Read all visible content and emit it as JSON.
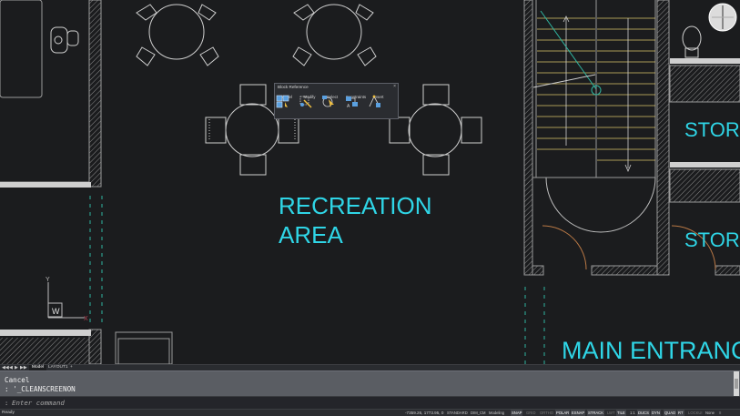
{
  "drawing": {
    "labels": {
      "recreation": "RECREATION",
      "area": "AREA",
      "storage_1": "STOR",
      "storage_2": "STOR",
      "main_entrance": "MAIN ENTRANC"
    },
    "ucs_label": "W",
    "ucs_y": "Y",
    "ucs_x": "X"
  },
  "context_toolbar": {
    "title": "Block Reference",
    "close": "×",
    "groups": [
      {
        "label": "Model",
        "icon": "model-icon"
      },
      {
        "label": "Modify",
        "icon": "modify-icon"
      },
      {
        "label": "Select",
        "icon": "select-icon"
      },
      {
        "label": "Constraints",
        "icon": "constraints-icon"
      },
      {
        "label": "Insert",
        "icon": "insert-icon"
      }
    ]
  },
  "layout_tabs": {
    "nav": [
      "◀◀",
      "◀",
      "▶",
      "▶▶"
    ],
    "tabs": [
      {
        "label": "Model",
        "active": true
      },
      {
        "label": "LAYOUT1",
        "active": false
      }
    ],
    "add": "+"
  },
  "command_window": {
    "history": [
      "Cancel",
      ": '_CLEANSCREENON"
    ],
    "prompt_prefix": ":",
    "input_value": "",
    "input_placeholder": "Enter command"
  },
  "status_bar": {
    "ready": "Ready",
    "coordinates": "-7359.26, 1773.95, 0",
    "buttons": [
      {
        "label": "STANDARD",
        "on": false
      },
      {
        "label": "DIM_CM",
        "on": false
      },
      {
        "label": "Modeling",
        "on": false
      },
      {
        "label": "SNAP",
        "on": true
      },
      {
        "label": "GRID",
        "on": false
      },
      {
        "label": "ORTHO",
        "on": false
      },
      {
        "label": "POLAR",
        "on": true
      },
      {
        "label": "ESNAP",
        "on": true
      },
      {
        "label": "STRACK",
        "on": true
      },
      {
        "label": "LWT",
        "on": false
      },
      {
        "label": "TILE",
        "on": true
      },
      {
        "label": "1:1",
        "on": false
      },
      {
        "label": "DUCS",
        "on": true
      },
      {
        "label": "DYN",
        "on": true
      },
      {
        "label": "QUAD",
        "on": true
      },
      {
        "label": "RT",
        "on": true
      },
      {
        "label": "LOCKUI",
        "on": false
      },
      {
        "label": "None",
        "on": false
      }
    ]
  },
  "colors": {
    "background": "#1b1c1e",
    "cad_text": "#2fd5e6",
    "wall": "#9a9a9a",
    "furniture": "#cfcfcf",
    "stair_line": "#d8c46a",
    "dashed_green": "#2fb5a0"
  }
}
